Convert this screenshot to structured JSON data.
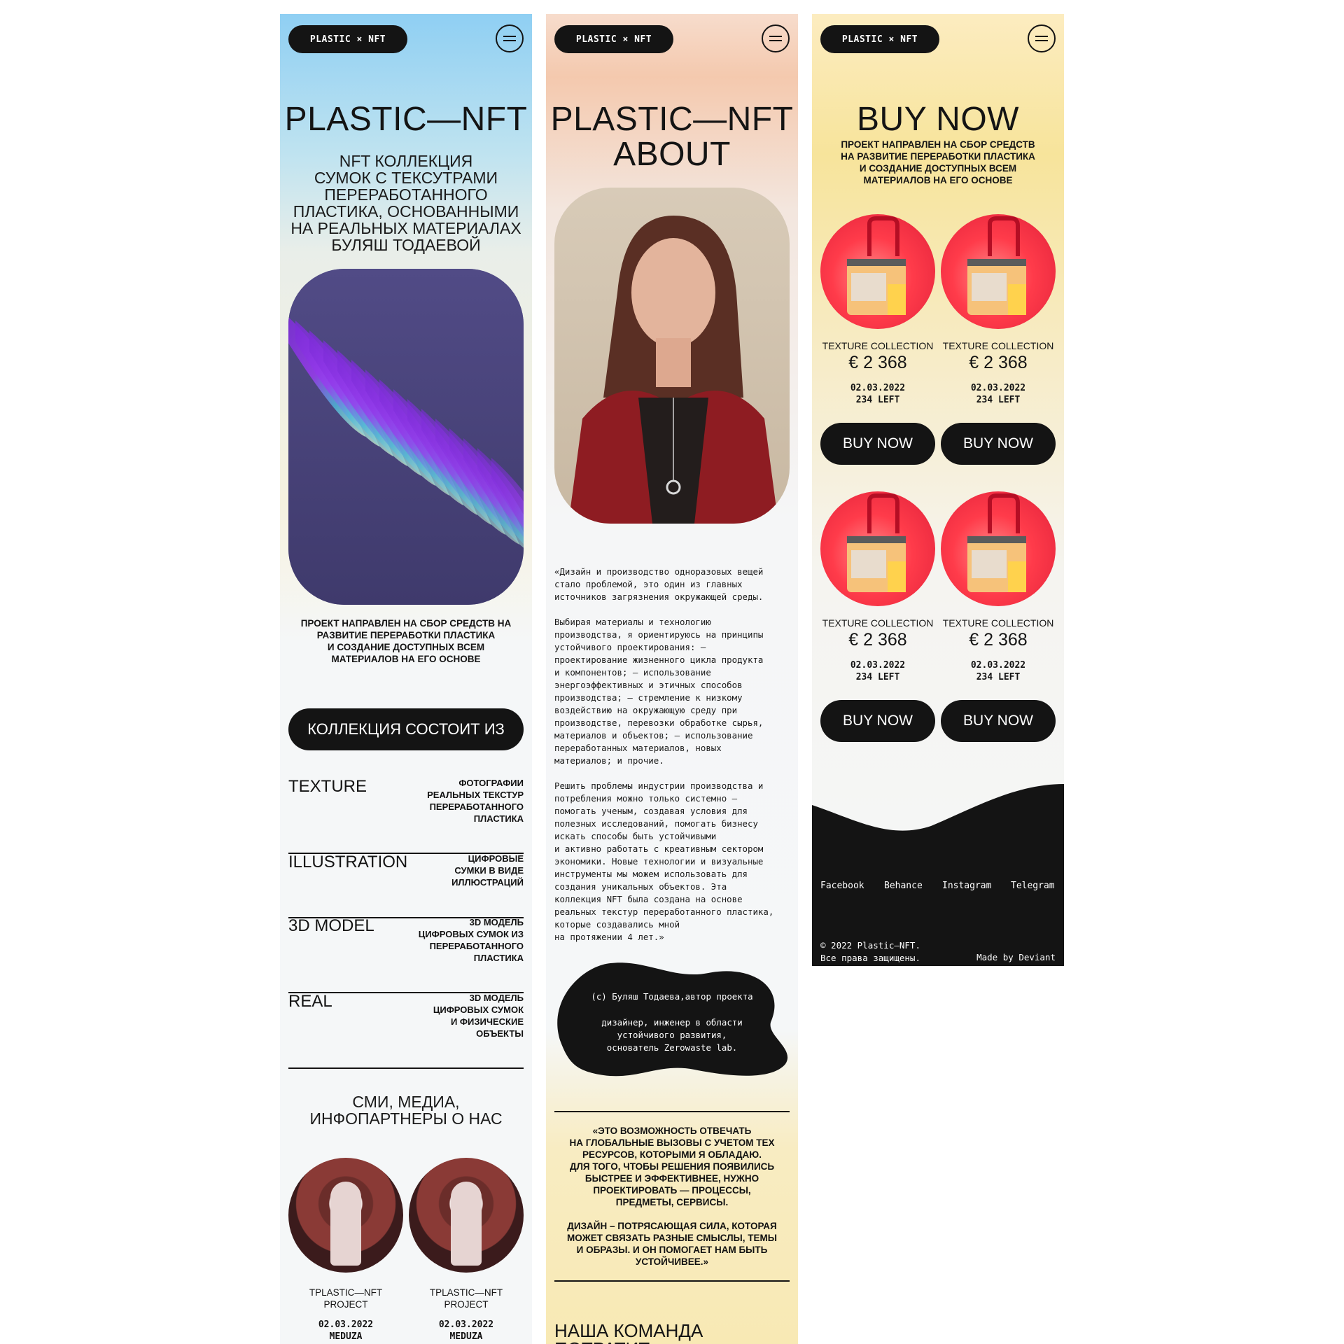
{
  "brand": {
    "logo": "PLASTIC × NFT"
  },
  "panel1": {
    "title": "PLASTIC—NFT",
    "subtitle": "NFT КОЛЛЕКЦИЯ\nСУМОК С ТЕКСУТРАМИ\nПЕРЕРАБОТАННОГО\nПЛАСТИКА, ОСНОВАННЫМИ\nНА РЕАЛЬНЫХ МАТЕРИАЛАХ\nБУЛЯШ ТОДАЕВОЙ",
    "mission": "ПРОЕКТ НАПРАВЛЕН НА СБОР СРЕДСТВ НА\nРАЗВИТИЕ ПЕРЕРАБОТКИ ПЛАСТИКА\nИ СОЗДАНИЕ ДОСТУПНЫХ ВСЕМ\nМАТЕРИАЛОВ НА ЕГО ОСНОВЕ",
    "collection_button": "КОЛЛЕКЦИЯ СОСТОИТ ИЗ",
    "collection": [
      {
        "title": "TEXTURE",
        "desc": "ФОТОГРАФИИ\nРЕАЛЬНЫХ ТЕКСТУР\nПЕРЕРАБОТАННОГО\nПЛАСТИКА"
      },
      {
        "title": "ILLUSTRATION",
        "desc": "ЦИФРОВЫЕ\nСУМКИ В ВИДЕ\nИЛЛЮСТРАЦИЙ"
      },
      {
        "title": "3D MODEL",
        "desc": "3D МОДЕЛЬ\nЦИФРОВЫХ СУМОК ИЗ\nПЕРЕРАБОТАННОГО\nПЛАСТИКА"
      },
      {
        "title": "REAL",
        "desc": "3D МОДЕЛЬ\nЦИФРОВЫХ СУМОК\nИ ФИЗИЧЕСКИЕ\nОБЪЕКТЫ"
      }
    ],
    "media_title": "СМИ, МЕДИА,\nИНФОПАРТНЕРЫ О НАС",
    "media": [
      {
        "name": "TPLASTIC—NFT\nPROJECT",
        "meta": "02.03.2022\nMEDUZA"
      },
      {
        "name": "TPLASTIC—NFT\nPROJECT",
        "meta": "02.03.2022\nMEDUZA"
      }
    ]
  },
  "panel2": {
    "title": "PLASTIC—NFT\nABOUT",
    "text1": "«Дизайн и производство одноразовых вещей\nстало проблемой, это один из главных\nисточников загрязнения окружающей среды.",
    "text2": "Выбирая материалы и технологию\nпроизводства, я ориентируюсь на принципы\nустойчивого проектирования: –\nпроектирование жизненного цикла продукта\nи компонентов; – использование\nэнергоэффективных и этичных способов\nпроизводства; – стремление к низкому\nвоздействию на окружающую среду при\nпроизводстве, перевозки обработке сырья,\nматериалов и объектов; – использование\nпереработанных материалов, новых\nматериалов; и прочие.",
    "text3": "Решить проблемы индустрии производства и\nпотребления можно только системно —\nпомогать ученым, создавая условия для\nполезных исследований, помогать бизнесу\nискать способы быть устойчивыми\nи активно работать с креативным сектором\nэкономики. Новые технологии и визуальные\nинструменты мы можем использовать для\nсоздания уникальных объектов. Эта\nколлекция NFT была создана на основе\nреальных текстур переработанного пластика,\nкоторые создавались мной\nна протяжении 4 лет.»",
    "author": "(с) Буляш Тодаева,автор проекта",
    "author_role": "дизайнер, инженер в области\nустойчивого развития,\nоснователь Zerowaste lab.",
    "quote1": "«ЭТО ВОЗМОЖНОСТЬ ОТВЕЧАТЬ\nНА ГЛОБАЛЬНЫЕ ВЫЗОВЫ С УЧЕТОМ ТЕХ\nРЕСУРСОВ, КОТОРЫМИ Я ОБЛАДАЮ.\nДЛЯ ТОГО, ЧТОБЫ РЕШЕНИЯ ПОЯВИЛИСЬ\nБЫСТРЕЕ И ЭФФЕКТИВНЕЕ, НУЖНО\nПРОЕКТИРОВАТЬ — ПРОЦЕССЫ,\nПРЕДМЕТЫ, СЕРВИСЫ.",
    "quote2": "ДИЗАЙН – ПОТРЯСАЮЩАЯ СИЛА, КОТОРАЯ\nМОЖЕТ СВЯЗАТЬ РАЗНЫЕ СМЫСЛЫ, ТЕМЫ\nИ ОБРАЗЫ. И ОН ПОМОГАЕТ НАМ БЫТЬ\nУСТОЙЧИВЕЕ.»",
    "team_title": "НАША КОМАНДА ПОТРАТИТ\nСРЕДСТВА С ПРОДАЖ"
  },
  "panel3": {
    "title": "BUY NOW",
    "mission": "ПРОЕКТ НАПРАВЛЕН НА СБОР СРЕДСТВ\nНА РАЗВИТИЕ ПЕРЕРАБОТКИ ПЛАСТИКА\nИ СОЗДАНИЕ ДОСТУПНЫХ ВСЕМ\nМАТЕРИАЛОВ НА ЕГО ОСНОВЕ",
    "products": [
      {
        "label": "TEXTURE COLLECTION",
        "price": "€ 2 368",
        "meta": "02.03.2022\n234 LEFT",
        "button": "BUY NOW"
      },
      {
        "label": "TEXTURE COLLECTION",
        "price": "€ 2 368",
        "meta": "02.03.2022\n234 LEFT",
        "button": "BUY NOW"
      },
      {
        "label": "TEXTURE COLLECTION",
        "price": "€ 2 368",
        "meta": "02.03.2022\n234 LEFT",
        "button": "BUY NOW"
      },
      {
        "label": "TEXTURE COLLECTION",
        "price": "€ 2 368",
        "meta": "02.03.2022\n234 LEFT",
        "button": "BUY NOW"
      }
    ],
    "footer": {
      "links": [
        "Facebook",
        "Behance",
        "Instagram",
        "Telegram"
      ],
      "copyright": "© 2022 Plastic—NFT.\nВсе права защищены.",
      "credit": "Made by Deviant"
    }
  },
  "colors": {
    "dark": "#141414",
    "accent_red": "#ff3b4a",
    "purple": "#4f4a7f"
  }
}
